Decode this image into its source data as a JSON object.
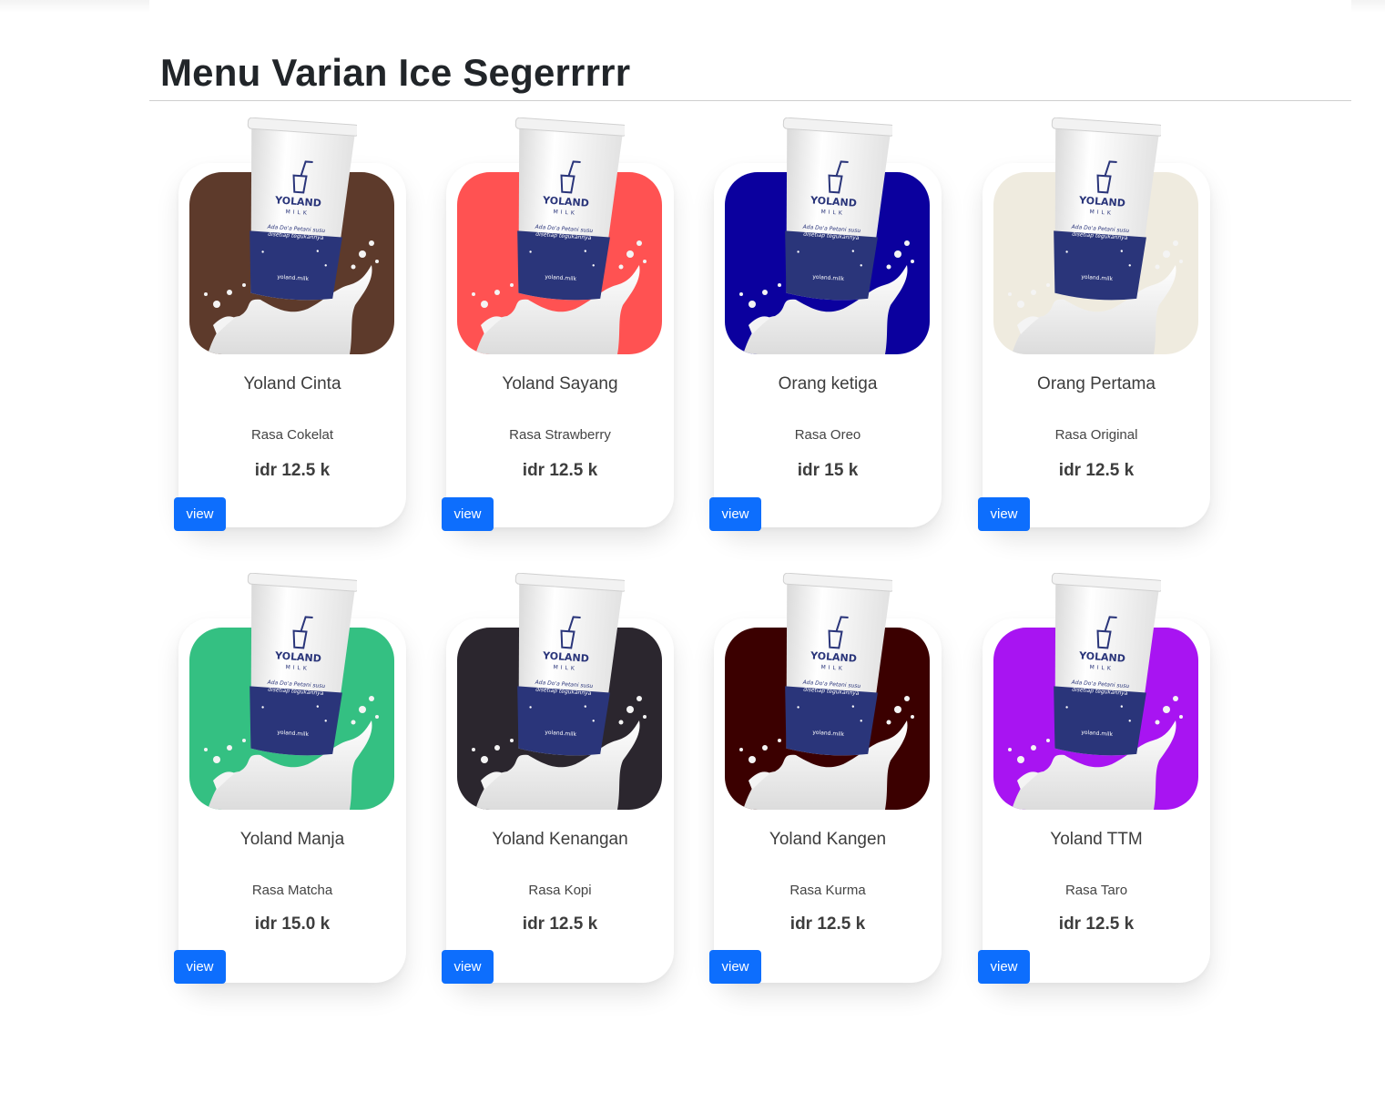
{
  "page": {
    "title": "Menu Varian Ice Segerrrrr"
  },
  "products": [
    {
      "name": "Yoland Cinta",
      "flavor": "Rasa Cokelat",
      "price": "idr 12.5 k",
      "button": "view",
      "bg_color": "#5d3a2b"
    },
    {
      "name": "Yoland Sayang",
      "flavor": "Rasa Strawberry",
      "price": "idr 12.5 k",
      "button": "view",
      "bg_color": "#ff5252"
    },
    {
      "name": "Orang ketiga",
      "flavor": "Rasa Oreo",
      "price": "idr 15 k",
      "button": "view",
      "bg_color": "#0b009e"
    },
    {
      "name": "Orang Pertama",
      "flavor": "Rasa Original",
      "price": "idr 12.5 k",
      "button": "view",
      "bg_color": "#efebdf"
    },
    {
      "name": "Yoland Manja",
      "flavor": "Rasa Matcha",
      "price": "idr 15.0 k",
      "button": "view",
      "bg_color": "#34c082"
    },
    {
      "name": "Yoland Kenangan",
      "flavor": "Rasa Kopi",
      "price": "idr 12.5 k",
      "button": "view",
      "bg_color": "#2b262e"
    },
    {
      "name": "Yoland Kangen",
      "flavor": "Rasa Kurma",
      "price": "idr 12.5 k",
      "button": "view",
      "bg_color": "#3b0000"
    },
    {
      "name": "Yoland TTM",
      "flavor": "Rasa Taro",
      "price": "idr 12.5 k",
      "button": "view",
      "bg_color": "#a814f2"
    }
  ],
  "cup_text": {
    "brand_line1": "YOLAND",
    "brand_line2": "MILK",
    "tagline_line1": "Ada Do'a Petani susu",
    "tagline_line2": "disetiap tegukannya",
    "handle": "yoland.milk"
  },
  "colors": {
    "button": "#0d6efd",
    "cup_band": "#2a357a"
  }
}
